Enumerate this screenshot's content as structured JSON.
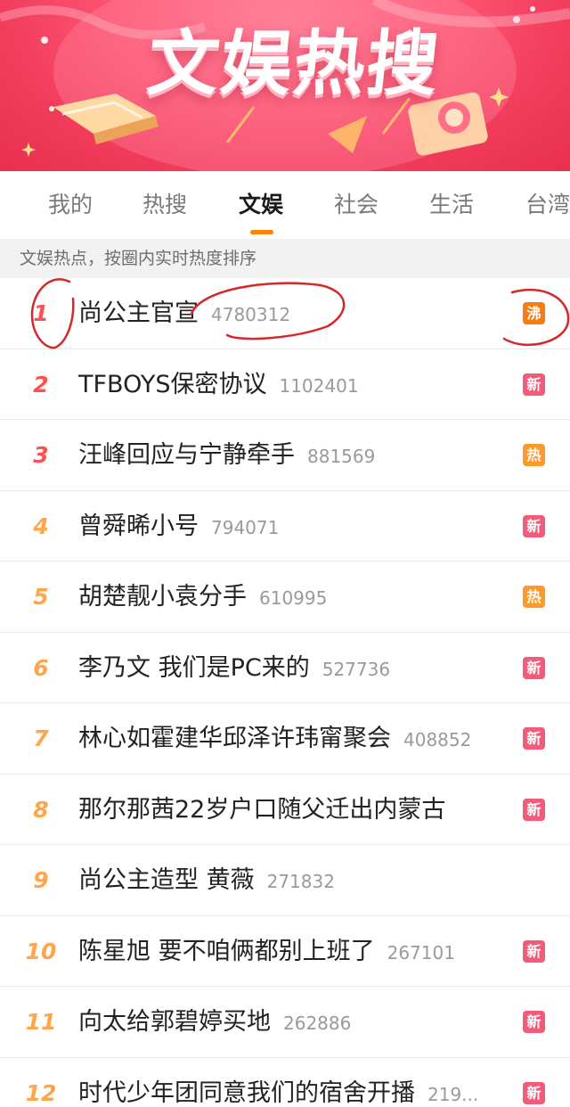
{
  "banner": {
    "title": "文娱热搜"
  },
  "tabs": [
    {
      "label": "我的",
      "active": false
    },
    {
      "label": "热搜",
      "active": false
    },
    {
      "label": "文娱",
      "active": true
    },
    {
      "label": "社会",
      "active": false
    },
    {
      "label": "生活",
      "active": false
    },
    {
      "label": "台湾",
      "active": false
    }
  ],
  "subheader": {
    "text": "文娱热点，按圈内实时热度排序"
  },
  "colors": {
    "accent": "#ff8200",
    "badge_new": "#f35b7a",
    "badge_hot": "#ff9a2a",
    "badge_boil": "#f77c12",
    "annotation": "#d62828"
  },
  "list": [
    {
      "rank": "1",
      "title": "尚公主官宣",
      "count": "4780312",
      "badge": "沸",
      "badge_type": "boil"
    },
    {
      "rank": "2",
      "title": "TFBOYS保密协议",
      "count": "1102401",
      "badge": "新",
      "badge_type": "new"
    },
    {
      "rank": "3",
      "title": "汪峰回应与宁静牵手",
      "count": "881569",
      "badge": "热",
      "badge_type": "hot"
    },
    {
      "rank": "4",
      "title": "曾舜晞小号",
      "count": "794071",
      "badge": "新",
      "badge_type": "new"
    },
    {
      "rank": "5",
      "title": "胡楚靓小袁分手",
      "count": "610995",
      "badge": "热",
      "badge_type": "hot"
    },
    {
      "rank": "6",
      "title": "李乃文 我们是PC来的",
      "count": "527736",
      "badge": "新",
      "badge_type": "new"
    },
    {
      "rank": "7",
      "title": "林心如霍建华邱泽许玮甯聚会",
      "count": "408852",
      "badge": "新",
      "badge_type": "new"
    },
    {
      "rank": "8",
      "title": "那尔那茜22岁户口随父迁出内蒙古",
      "count": "",
      "badge": "新",
      "badge_type": "new"
    },
    {
      "rank": "9",
      "title": "尚公主造型 黄薇",
      "count": "271832",
      "badge": "",
      "badge_type": ""
    },
    {
      "rank": "10",
      "title": "陈星旭 要不咱俩都别上班了",
      "count": "267101",
      "badge": "新",
      "badge_type": "new"
    },
    {
      "rank": "11",
      "title": "向太给郭碧婷买地",
      "count": "262886",
      "badge": "新",
      "badge_type": "new"
    },
    {
      "rank": "12",
      "title": "时代少年团同意我们的宿舍开播",
      "count": "219...",
      "badge": "新",
      "badge_type": "new"
    }
  ]
}
